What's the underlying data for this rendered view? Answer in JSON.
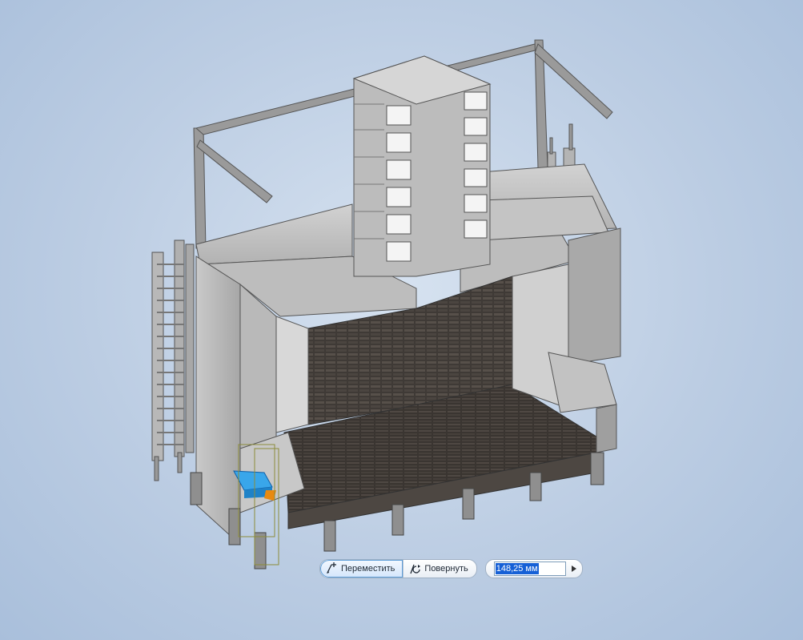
{
  "toolbar": {
    "move_label": "Переместить",
    "rotate_label": "Повернуть",
    "value": "148,25 мм"
  },
  "icons": {
    "move": "move-arrows-icon",
    "rotate": "rotate-icon",
    "expand": "triangle-right-icon"
  },
  "colors": {
    "background": "#bccde3",
    "selection": "#3aa0e0",
    "accent": "#e88a10"
  }
}
